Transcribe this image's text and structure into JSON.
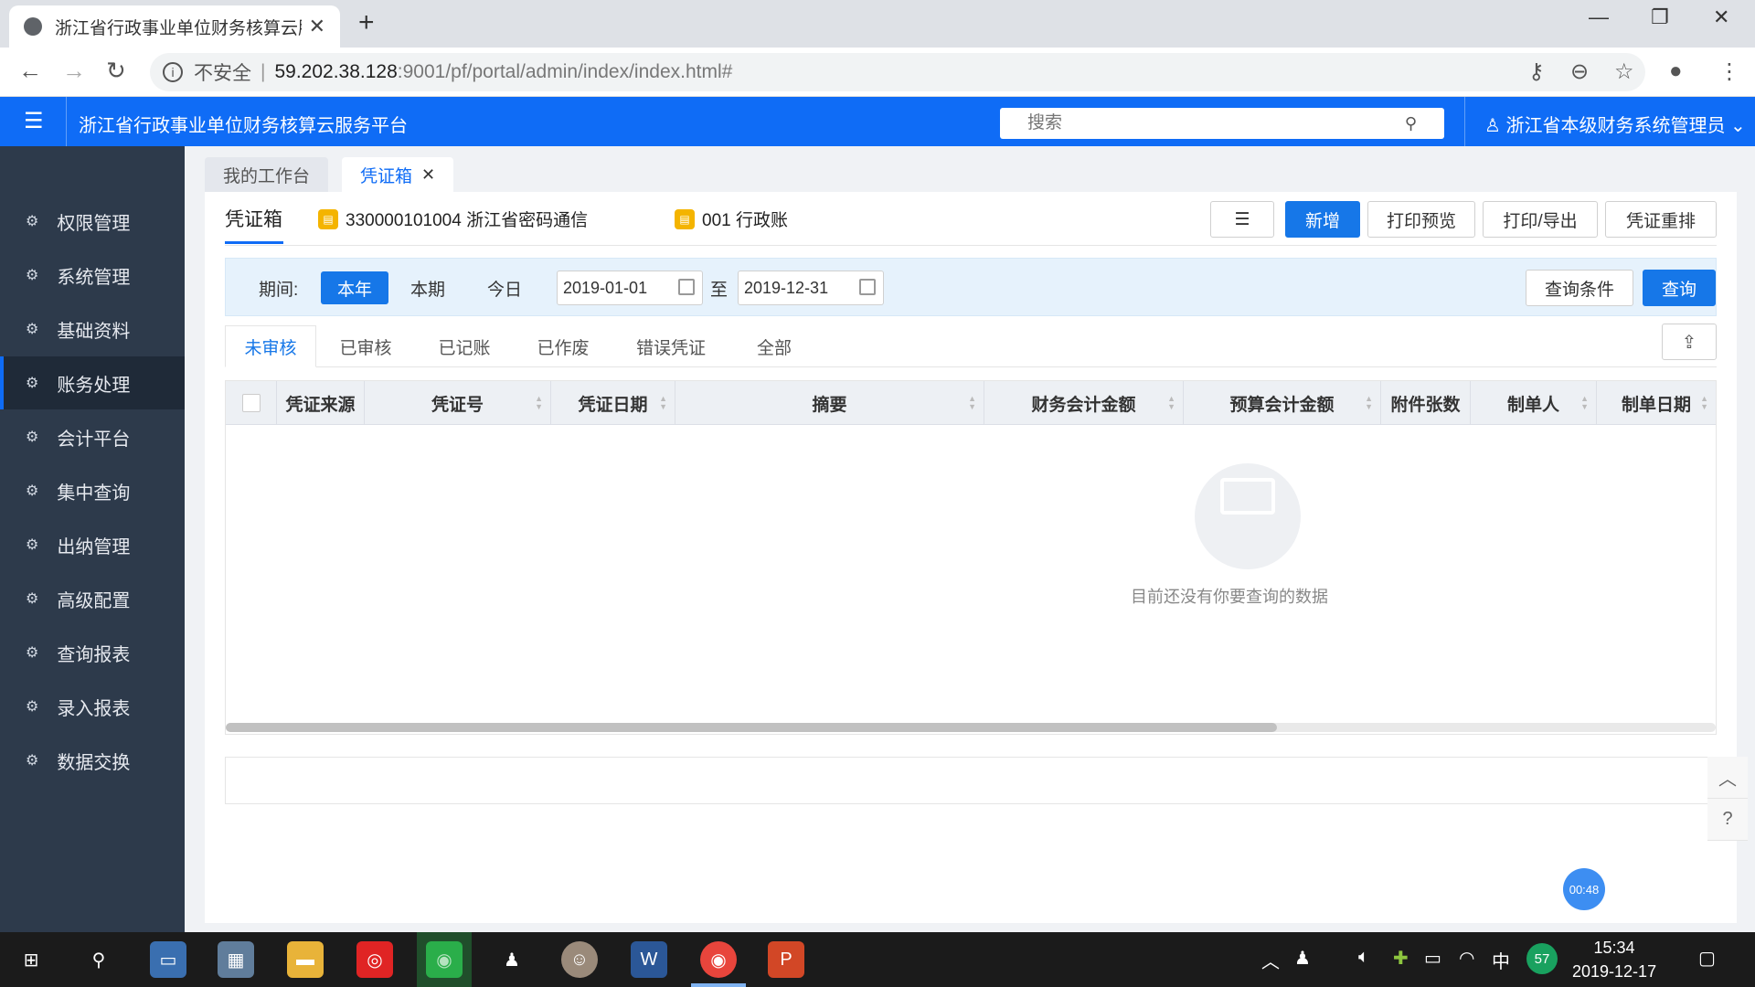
{
  "browser": {
    "tab_title": "浙江省行政事业单位财务核算云服",
    "new_tab": "+",
    "window_minimize": "—",
    "window_restore": "❐",
    "window_close": "✕",
    "insecure_label": "不安全",
    "url_host": "59.202.38.128",
    "url_path": ":9001/pf/portal/admin/index/index.html#"
  },
  "header": {
    "menu_icon": "☰",
    "app_title": "浙江省行政事业单位财务核算云服务平台",
    "search_placeholder": "搜索",
    "user_label": "浙江省本级财务系统管理员"
  },
  "sidebar": {
    "items": [
      {
        "label": "权限管理"
      },
      {
        "label": "系统管理"
      },
      {
        "label": "基础资料"
      },
      {
        "label": "账务处理"
      },
      {
        "label": "会计平台"
      },
      {
        "label": "集中查询"
      },
      {
        "label": "出纳管理"
      },
      {
        "label": "高级配置"
      },
      {
        "label": "查询报表"
      },
      {
        "label": "录入报表"
      },
      {
        "label": "数据交换"
      }
    ],
    "active_index": 3
  },
  "tabs": {
    "workbench": "我的工作台",
    "voucher_box": "凭证箱"
  },
  "panel": {
    "title": "凭证箱",
    "unit": "330000101004 浙江省密码通信",
    "ledger": "001 行政账",
    "buttons": {
      "list": "☰",
      "add": "新增",
      "print_preview": "打印预览",
      "print_export": "打印/导出",
      "renumber": "凭证重排"
    }
  },
  "filter": {
    "period_label": "期间:",
    "this_year": "本年",
    "this_period": "本期",
    "today": "今日",
    "date_from": "2019-01-01",
    "to_label": "至",
    "date_to": "2019-12-31",
    "query_conditions": "查询条件",
    "query": "查询"
  },
  "subtabs": [
    "未审核",
    "已审核",
    "已记账",
    "已作废",
    "错误凭证",
    "全部"
  ],
  "table": {
    "columns": [
      "凭证来源",
      "凭证号",
      "凭证日期",
      "摘要",
      "财务会计金额",
      "预算会计金额",
      "附件张数",
      "制单人",
      "制单日期"
    ],
    "empty_message": "目前还没有你要查询的数据"
  },
  "timer": "00:48",
  "taskbar": {
    "ime": "中",
    "badge": "57",
    "time": "15:34",
    "date": "2019-12-17"
  },
  "colors": {
    "brand": "#0f6cf6",
    "sidebar_bg": "#2d3a4b",
    "primary_button": "#1677e8"
  }
}
